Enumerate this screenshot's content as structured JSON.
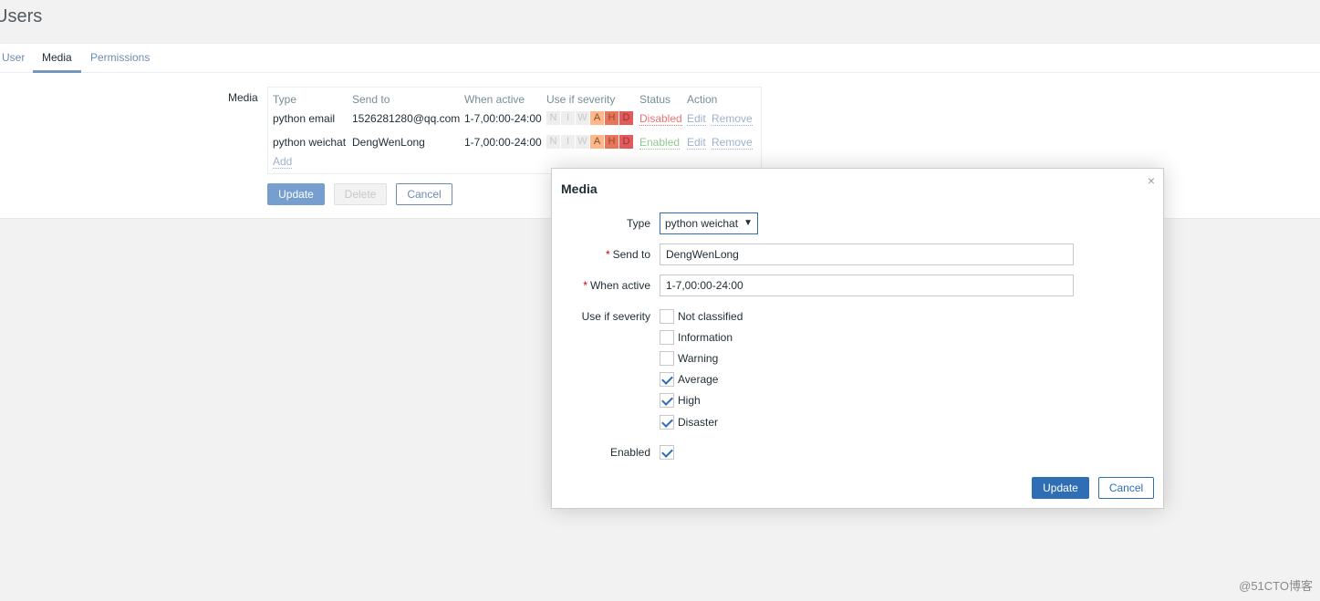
{
  "page": {
    "title": "Users"
  },
  "tabs": [
    {
      "label": "User",
      "active": false
    },
    {
      "label": "Media",
      "active": true
    },
    {
      "label": "Permissions",
      "active": false
    }
  ],
  "media_section": {
    "label": "Media",
    "columns": [
      "Type",
      "Send to",
      "When active",
      "Use if severity",
      "Status",
      "Action"
    ],
    "rows": [
      {
        "type": "python email",
        "send_to": "1526281280@qq.com",
        "when_active": "1-7,00:00-24:00",
        "severity": [
          "N",
          "I",
          "W",
          "A",
          "H",
          "D"
        ],
        "severity_enabled": [
          false,
          false,
          false,
          true,
          true,
          true
        ],
        "status": "Disabled",
        "edit": "Edit",
        "remove": "Remove"
      },
      {
        "type": "python weichat",
        "send_to": "DengWenLong",
        "when_active": "1-7,00:00-24:00",
        "severity": [
          "N",
          "I",
          "W",
          "A",
          "H",
          "D"
        ],
        "severity_enabled": [
          false,
          false,
          false,
          true,
          true,
          true
        ],
        "status": "Enabled",
        "edit": "Edit",
        "remove": "Remove"
      }
    ],
    "add_label": "Add",
    "buttons": {
      "update": "Update",
      "delete": "Delete",
      "cancel": "Cancel"
    }
  },
  "modal": {
    "title": "Media",
    "close_icon": "×",
    "type_label": "Type",
    "type_value": "python weichat",
    "type_arrow": "▼",
    "send_to_label": "Send to",
    "send_to_value": "DengWenLong",
    "when_active_label": "When active",
    "when_active_value": "1-7,00:00-24:00",
    "required_mark": "*",
    "severity_label": "Use if severity",
    "severities": [
      {
        "label": "Not classified",
        "checked": false
      },
      {
        "label": "Information",
        "checked": false
      },
      {
        "label": "Warning",
        "checked": false
      },
      {
        "label": "Average",
        "checked": true
      },
      {
        "label": "High",
        "checked": true
      },
      {
        "label": "Disaster",
        "checked": true
      }
    ],
    "enabled_label": "Enabled",
    "enabled_checked": true,
    "buttons": {
      "update": "Update",
      "cancel": "Cancel"
    }
  },
  "watermark": "@51CTO博客"
}
